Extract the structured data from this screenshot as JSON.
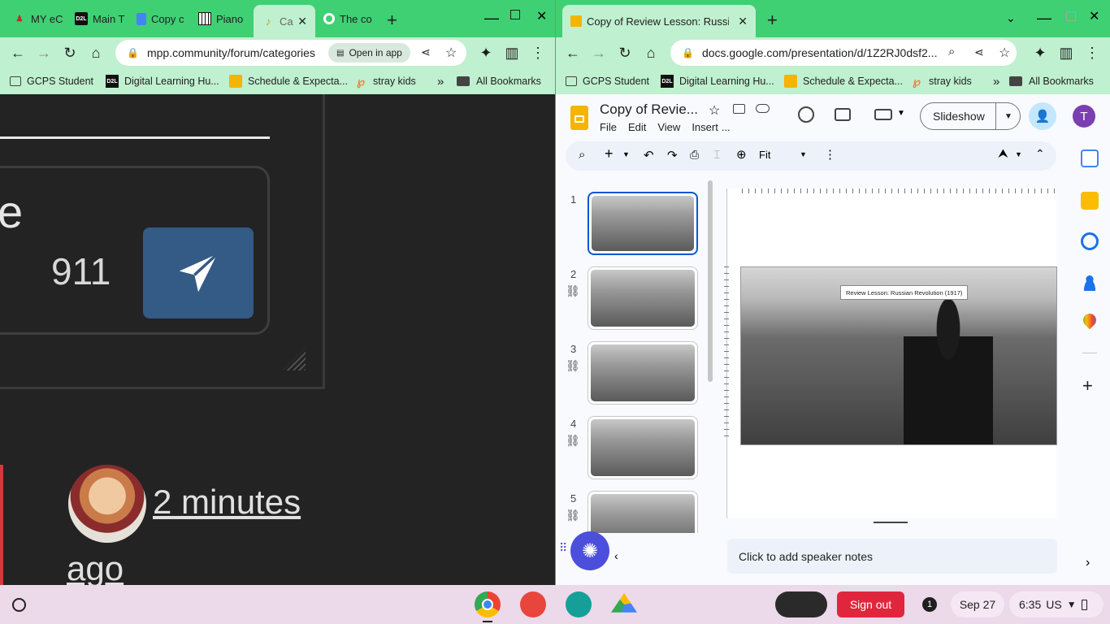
{
  "left_window": {
    "tabs": [
      {
        "label": "MY eC",
        "icon": "red-person-icon"
      },
      {
        "label": "Main T",
        "icon": "d2l-icon"
      },
      {
        "label": "Copy c",
        "icon": "google-docs-icon"
      },
      {
        "label": "Piano",
        "icon": "piano-icon"
      },
      {
        "label": "Ca",
        "icon": "musical-note-icon",
        "active": true
      },
      {
        "label": "The co",
        "icon": "google-icon"
      }
    ],
    "url": "mpp.community/forum/categories",
    "open_in_app": "Open in app",
    "bookmarks": [
      {
        "label": "GCPS Student",
        "icon": "briefcase-icon"
      },
      {
        "label": "Digital Learning Hu...",
        "icon": "d2l-icon"
      },
      {
        "label": "Schedule & Expecta...",
        "icon": "slides-icon"
      },
      {
        "label": "stray kids",
        "icon": "p-icon"
      }
    ],
    "overflow": "»",
    "all_bookmarks": "All Bookmarks",
    "page": {
      "partial_letter": "e",
      "count": "911",
      "post_time": "2 minutes",
      "post_time_2": "ago"
    }
  },
  "right_window": {
    "tab": {
      "label": "Copy of Review Lesson: Russian",
      "icon": "slides-icon"
    },
    "url": "docs.google.com/presentation/d/1Z2RJ0dsf2...",
    "bookmarks": [
      {
        "label": "GCPS Student",
        "icon": "briefcase-icon"
      },
      {
        "label": "Digital Learning Hu...",
        "icon": "d2l-icon"
      },
      {
        "label": "Schedule & Expecta...",
        "icon": "slides-icon"
      },
      {
        "label": "stray kids",
        "icon": "p-icon"
      }
    ],
    "overflow": "»",
    "all_bookmarks": "All Bookmarks",
    "doc_title": "Copy of Revie...",
    "menus": [
      "File",
      "Edit",
      "View",
      "Insert",
      "..."
    ],
    "slideshow_label": "Slideshow",
    "avatar_letter": "T",
    "zoom_label": "Fit",
    "slide_numbers": [
      "1",
      "2",
      "3",
      "4",
      "5"
    ],
    "slide_title_box": "Review Lesson: Russian Revolution (1917)",
    "speaker_notes": "Click to add speaker notes"
  },
  "shelf": {
    "sign_out": "Sign out",
    "notification_count": "1",
    "date": "Sep 27",
    "time": "6:35",
    "locale": "US"
  },
  "colors": {
    "tabstrip": "#3fd073",
    "toolbar": "#bff0cf",
    "forum_bg": "#232323",
    "send_button": "#345a86",
    "sign_out": "#e0263d"
  }
}
